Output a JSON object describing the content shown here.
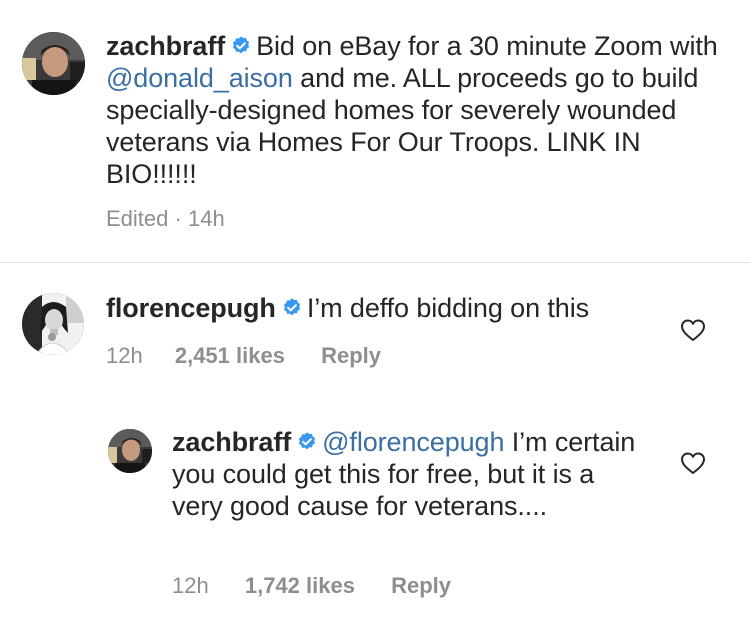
{
  "caption": {
    "username": "zachbraff",
    "text_before_mention": "Bid on eBay for a 30 minute Zoom with ",
    "mention": "@donald_aison",
    "text_after_mention": " and me. ALL proceeds go to build specially-designed homes for severely wounded veterans via Homes For Our Troops. LINK IN BIO!!!!!!",
    "edited_label": "Edited",
    "separator": "·",
    "time": "14h"
  },
  "comments": [
    {
      "username": "florencepugh",
      "text": "I’m deffo bidding on this",
      "time": "12h",
      "likes": "2,451 likes",
      "reply_label": "Reply"
    }
  ],
  "reply": {
    "username": "zachbraff",
    "mention": "@florencepugh",
    "text": " I’m certain you could get this for free, but it is a very good cause for veterans....",
    "time": "12h",
    "likes": "1,742 likes",
    "reply_label": "Reply"
  },
  "icons": {
    "verified": "verified-badge-icon",
    "like": "heart-outline-icon"
  },
  "colors": {
    "mention": "#3a6ea5",
    "verified": "#3897f0",
    "meta": "#8e8e8e",
    "text": "#262626"
  }
}
